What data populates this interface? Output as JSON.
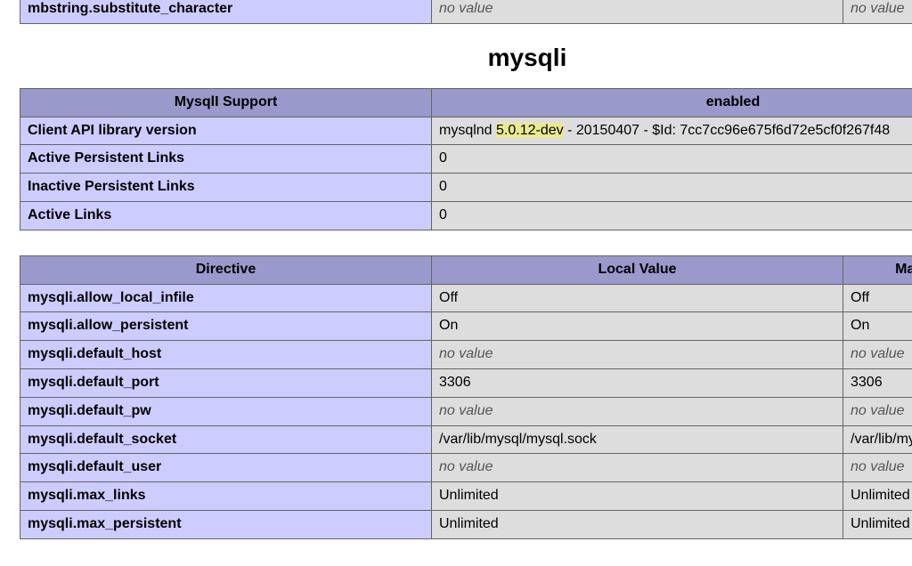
{
  "topRow": {
    "name": "mbstring.substitute_character",
    "local": "no value",
    "master": "no value"
  },
  "sectionTitle": "mysqli",
  "supportTable": {
    "headers": [
      "MysqlI Support",
      "enabled"
    ],
    "rows": [
      {
        "name": "Client API library version",
        "value_prefix": "mysqlnd ",
        "value_hl": "5.0.12-dev",
        "value_suffix": " - 20150407 - $Id: 7cc7cc96e675f6d72e5cf0f267f48",
        "raw": false
      },
      {
        "name": "Active Persistent Links",
        "value": "0"
      },
      {
        "name": "Inactive Persistent Links",
        "value": "0"
      },
      {
        "name": "Active Links",
        "value": "0"
      }
    ]
  },
  "directiveTable": {
    "headers": [
      "Directive",
      "Local Value",
      "Master Value"
    ],
    "rows": [
      {
        "name": "mysqli.allow_local_infile",
        "local": "Off",
        "master": "Off"
      },
      {
        "name": "mysqli.allow_persistent",
        "local": "On",
        "master": "On"
      },
      {
        "name": "mysqli.default_host",
        "local": "no value",
        "master": "no value"
      },
      {
        "name": "mysqli.default_port",
        "local": "3306",
        "master": "3306"
      },
      {
        "name": "mysqli.default_pw",
        "local": "no value",
        "master": "no value"
      },
      {
        "name": "mysqli.default_socket",
        "local": "/var/lib/mysql/mysql.sock",
        "master": "/var/lib/mysql/mysql.sock"
      },
      {
        "name": "mysqli.default_user",
        "local": "no value",
        "master": "no value"
      },
      {
        "name": "mysqli.max_links",
        "local": "Unlimited",
        "master": "Unlimited"
      },
      {
        "name": "mysqli.max_persistent",
        "local": "Unlimited",
        "master": "Unlimited"
      }
    ]
  },
  "noValueText": "no value"
}
